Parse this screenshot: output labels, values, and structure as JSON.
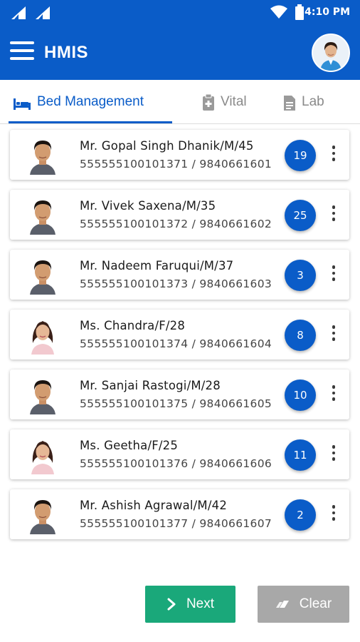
{
  "status_bar": {
    "time": "4:10 PM"
  },
  "app_bar": {
    "title": "HMIS"
  },
  "tabs": [
    {
      "label": "Bed Management",
      "icon": "bed-icon",
      "active": true
    },
    {
      "label": "Vital",
      "icon": "clipboard-icon",
      "active": false
    },
    {
      "label": "Lab",
      "icon": "lab-report-icon",
      "active": false
    }
  ],
  "patients": [
    {
      "name": "Mr. Gopal Singh Dhanik/M/45",
      "ids": "555555100101371 / 9840661601",
      "bed": "19",
      "gender": "M"
    },
    {
      "name": "Mr. Vivek Saxena/M/35",
      "ids": "555555100101372 / 9840661602",
      "bed": "25",
      "gender": "M"
    },
    {
      "name": "Mr. Nadeem Faruqui/M/37",
      "ids": "555555100101373 / 9840661603",
      "bed": "3",
      "gender": "M"
    },
    {
      "name": "Ms. Chandra/F/28",
      "ids": "555555100101374 / 9840661604",
      "bed": "8",
      "gender": "F"
    },
    {
      "name": "Mr. Sanjai Rastogi/M/28",
      "ids": "555555100101375 / 9840661605",
      "bed": "10",
      "gender": "M"
    },
    {
      "name": "Ms. Geetha/F/25",
      "ids": "555555100101376 / 9840661606",
      "bed": "11",
      "gender": "F"
    },
    {
      "name": "Mr. Ashish Agrawal/M/42",
      "ids": "555555100101377 / 9840661607",
      "bed": "2",
      "gender": "M"
    }
  ],
  "actions": {
    "next_label": "Next",
    "clear_label": "Clear"
  },
  "colors": {
    "primary": "#0a5cc8",
    "next": "#1aa87a",
    "clear": "#a8a8a8"
  }
}
